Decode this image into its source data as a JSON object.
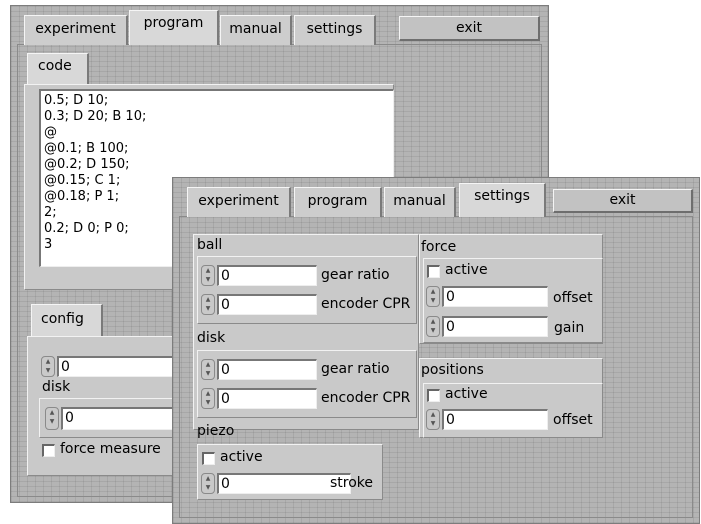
{
  "back_window": {
    "tabs": [
      "experiment",
      "program",
      "manual",
      "settings"
    ],
    "exit_label": "exit",
    "code_tab": "code",
    "code_lines": [
      "0.5; D 10;",
      "0.3; D 20; B 10;",
      "@",
      "@0.1; B 100;",
      "@0.2; D 150;",
      "@0.15; C 1;",
      "@0.18; P 1;",
      "2;",
      "0.2; D 0; P 0;",
      "3"
    ],
    "config_tab": "config",
    "value_1": "0",
    "disk_label": "disk",
    "disk_value": "0",
    "force_measure_label": "force measure"
  },
  "front_window": {
    "tabs": [
      "experiment",
      "program",
      "manual",
      "settings"
    ],
    "exit_label": "exit",
    "ball": {
      "title": "ball",
      "gear_ratio_value": "0",
      "gear_ratio_label": "gear ratio",
      "encoder_cpr_value": "0",
      "encoder_cpr_label": "encoder CPR"
    },
    "disk": {
      "title": "disk",
      "gear_ratio_value": "0",
      "gear_ratio_label": "gear ratio",
      "encoder_cpr_value": "0",
      "encoder_cpr_label": "encoder CPR"
    },
    "piezo": {
      "title": "piezo",
      "active_label": "active",
      "stroke_value": "0",
      "stroke_label": "stroke"
    },
    "force": {
      "title": "force",
      "active_label": "active",
      "offset_value": "0",
      "offset_label": "offset",
      "gain_value": "0",
      "gain_label": "gain"
    },
    "positions": {
      "title": "positions",
      "active_label": "active",
      "offset_value": "0",
      "offset_label": "offset"
    }
  }
}
